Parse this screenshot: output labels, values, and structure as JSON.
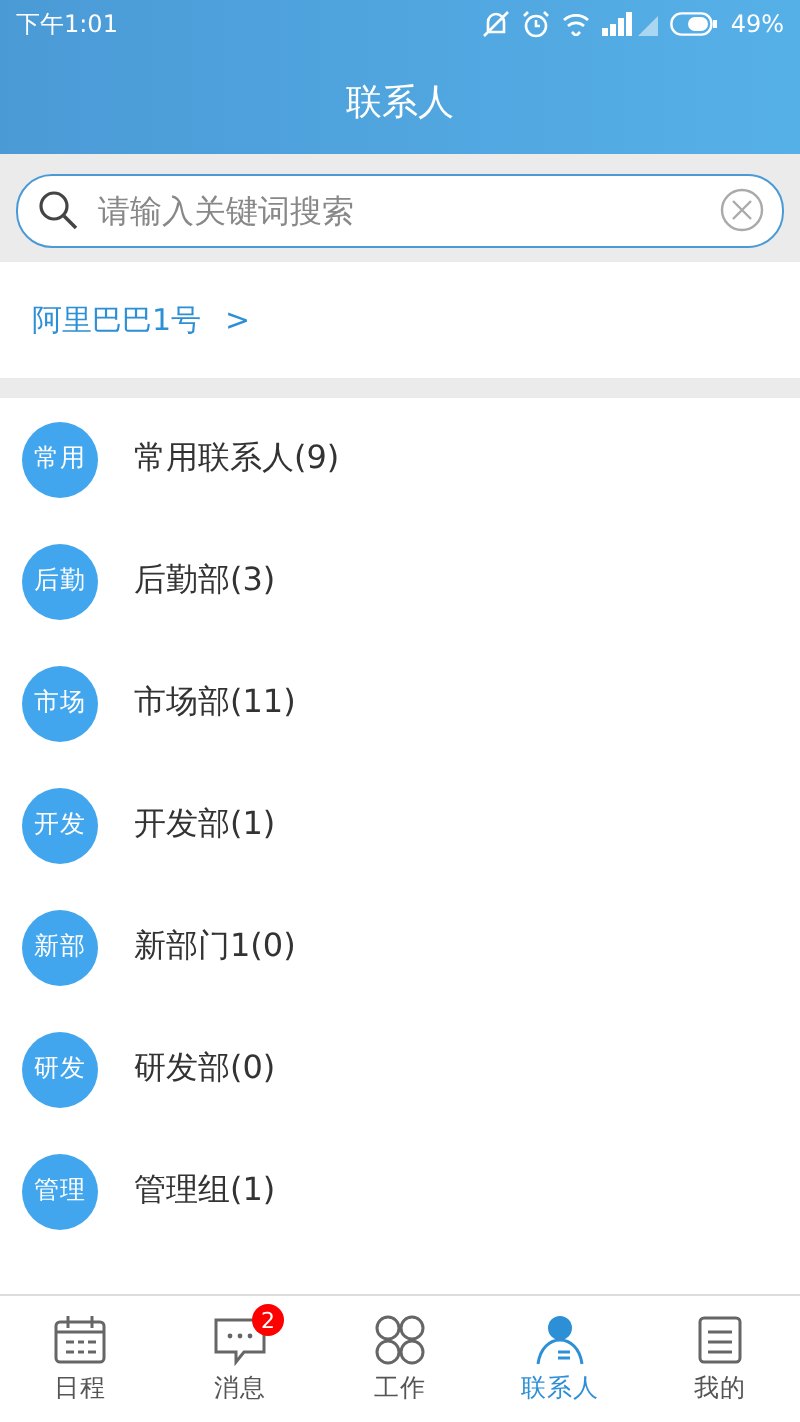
{
  "status_bar": {
    "time": "下午1:01",
    "battery": "49%"
  },
  "header": {
    "title": "联系人"
  },
  "search": {
    "placeholder": "请输入关键词搜索"
  },
  "company": {
    "name": "阿里巴巴1号",
    "arrow": ">"
  },
  "groups": [
    {
      "badge": "常用",
      "name": "常用联系人(9)"
    },
    {
      "badge": "后勤",
      "name": "后勤部(3)"
    },
    {
      "badge": "市场",
      "name": "市场部(11)"
    },
    {
      "badge": "开发",
      "name": "开发部(1)"
    },
    {
      "badge": "新部",
      "name": "新部门1(0)"
    },
    {
      "badge": "研发",
      "name": "研发部(0)"
    },
    {
      "badge": "管理",
      "name": "管理组(1)"
    }
  ],
  "nav": [
    {
      "kind": "calendar",
      "label": "日程",
      "selected": false
    },
    {
      "kind": "message",
      "label": "消息",
      "selected": false,
      "badge": "2"
    },
    {
      "kind": "work",
      "label": "工作",
      "selected": false
    },
    {
      "kind": "contacts",
      "label": "联系人",
      "selected": true
    },
    {
      "kind": "profile",
      "label": "我的",
      "selected": false
    }
  ]
}
